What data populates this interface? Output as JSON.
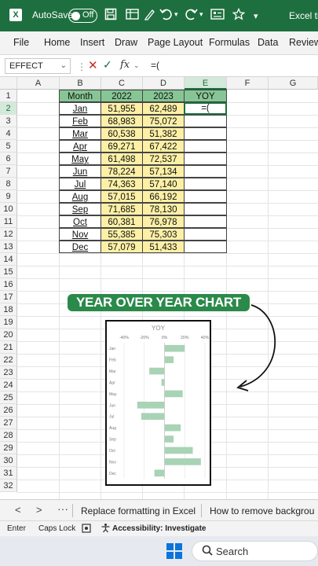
{
  "titlebar": {
    "app_icon": "excel-icon",
    "autosave_label": "AutoSave",
    "autosave_state": "Off",
    "title": "Excel tip"
  },
  "ribbon": {
    "tabs": [
      "File",
      "Home",
      "Insert",
      "Draw",
      "Page Layout",
      "Formulas",
      "Data",
      "Review"
    ]
  },
  "formula_bar": {
    "name_box": "EFFECT",
    "cancel_icon": "✕",
    "enter_icon": "✓",
    "fx_label": "fx",
    "formula": "=("
  },
  "columns": [
    "A",
    "B",
    "C",
    "D",
    "E",
    "F",
    "G"
  ],
  "rows": [
    "1",
    "2",
    "3",
    "4",
    "5",
    "6",
    "7",
    "8",
    "9",
    "10",
    "11",
    "12",
    "13",
    "14",
    "15",
    "16",
    "17",
    "18",
    "19",
    "20",
    "21",
    "22",
    "23",
    "24",
    "25",
    "26",
    "27",
    "28",
    "29",
    "30",
    "31",
    "32"
  ],
  "table": {
    "headers": [
      "Month",
      "2022",
      "2023",
      "YOY"
    ],
    "rows": [
      {
        "month": "Jan",
        "y2022": "51,955",
        "y2023": "62,489"
      },
      {
        "month": "Feb",
        "y2022": "68,983",
        "y2023": "75,072"
      },
      {
        "month": "Mar",
        "y2022": "60,538",
        "y2023": "51,382"
      },
      {
        "month": "Apr",
        "y2022": "69,271",
        "y2023": "67,422"
      },
      {
        "month": "May",
        "y2022": "61,498",
        "y2023": "72,537"
      },
      {
        "month": "Jun",
        "y2022": "78,224",
        "y2023": "57,134"
      },
      {
        "month": "Jul",
        "y2022": "74,363",
        "y2023": "57,140"
      },
      {
        "month": "Aug",
        "y2022": "57,015",
        "y2023": "66,192"
      },
      {
        "month": "Sep",
        "y2022": "71,685",
        "y2023": "78,130"
      },
      {
        "month": "Oct",
        "y2022": "60,381",
        "y2023": "76,978"
      },
      {
        "month": "Nov",
        "y2022": "55,385",
        "y2023": "75,303"
      },
      {
        "month": "Dec",
        "y2022": "57,079",
        "y2023": "51,433"
      }
    ],
    "editing_value": "=("
  },
  "banner": "YEAR OVER YEAR CHART",
  "chart_data": {
    "type": "bar",
    "orientation": "horizontal",
    "title": "YOY",
    "xlabel": "",
    "ylabel": "",
    "xlim": [
      -40,
      40
    ],
    "x_ticks": [
      "-40%",
      "-20%",
      "0%",
      "20%",
      "40%"
    ],
    "categories": [
      "Jan",
      "Feb",
      "Mar",
      "Apr",
      "May",
      "Jun",
      "Jul",
      "Aug",
      "Sep",
      "Oct",
      "Nov",
      "Dec"
    ],
    "values": [
      20,
      9,
      -15,
      -3,
      18,
      -27,
      -23,
      16,
      9,
      28,
      36,
      -10
    ],
    "bar_color": "#a9d3b5",
    "grid": true
  },
  "sheet_tabs": {
    "prev": "<",
    "next": ">",
    "more": "···",
    "tabs": [
      "Replace formatting in Excel",
      "How to remove backgrou"
    ]
  },
  "status_bar": {
    "mode": "Enter",
    "caps": "Caps Lock",
    "accessibility": "Accessibility: Investigate"
  },
  "taskbar": {
    "search_label": "Search"
  },
  "colors": {
    "excel_green": "#1e6f3f",
    "header_green": "#86c694",
    "value_yellow": "#fdf0a6"
  }
}
